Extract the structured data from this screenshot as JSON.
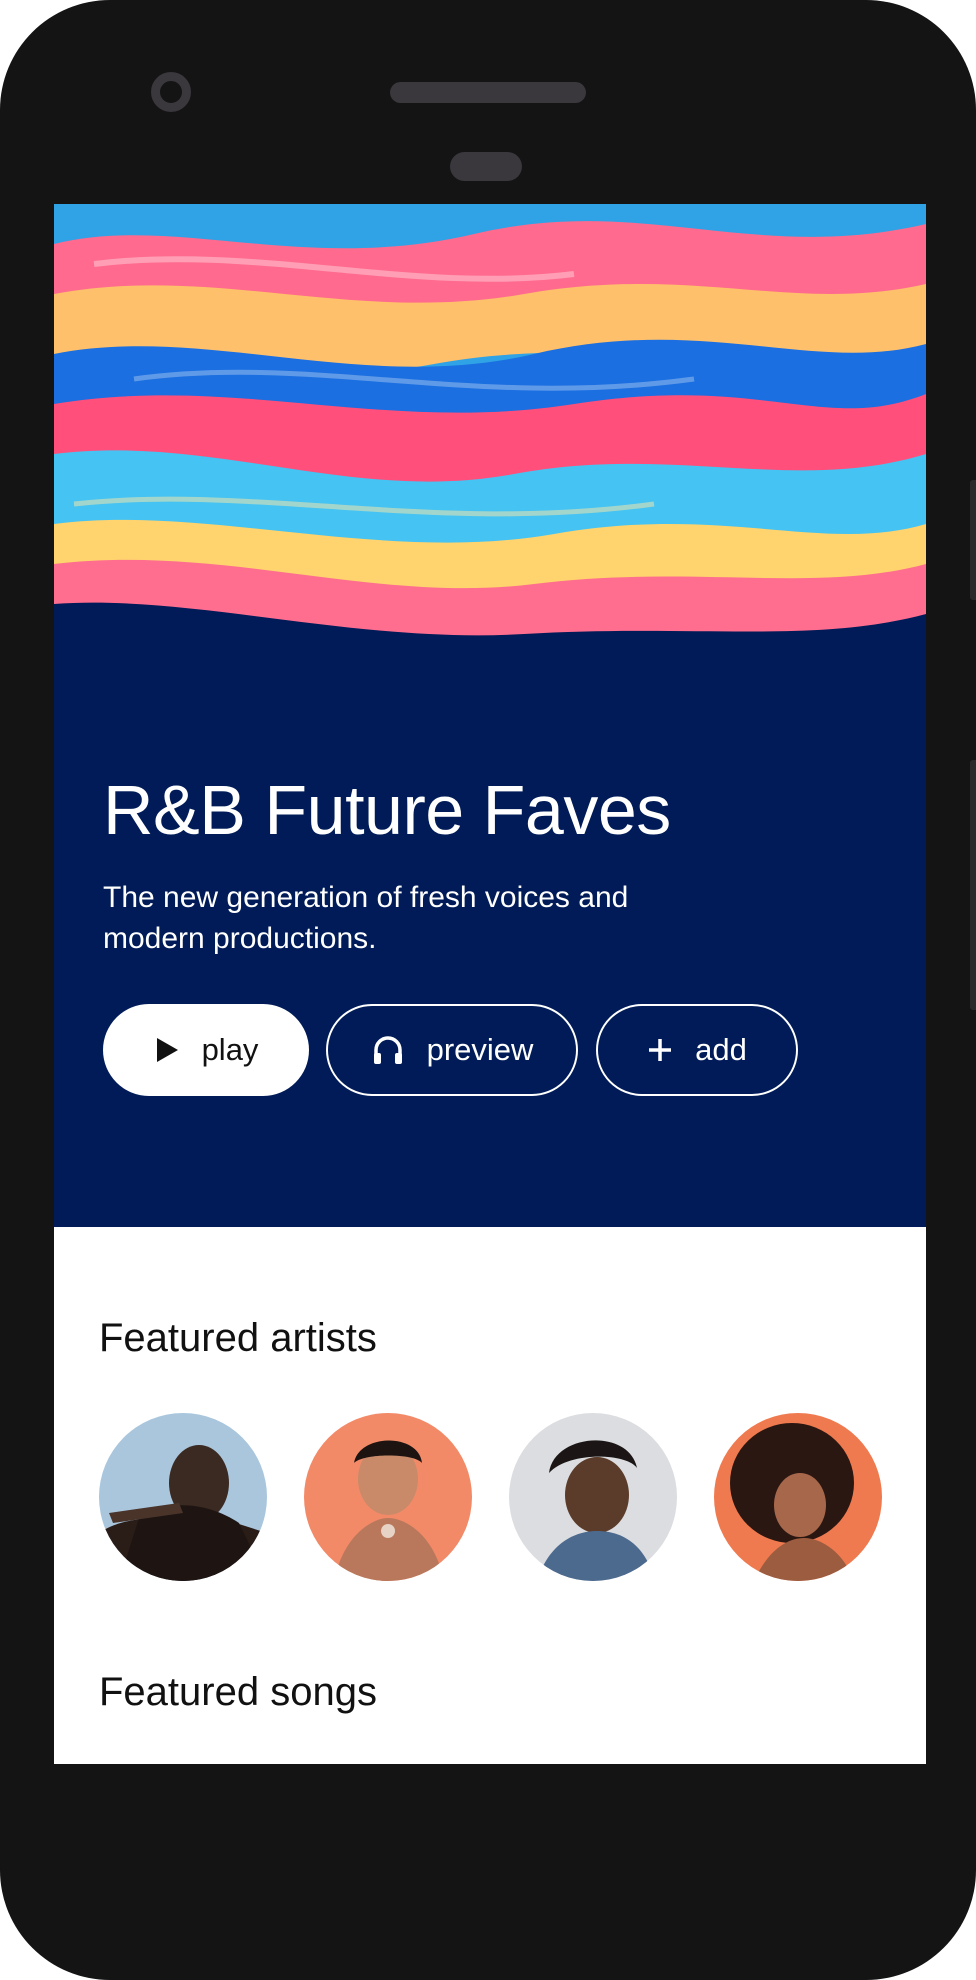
{
  "playlist": {
    "title": "R&B Future Faves",
    "description": "The new generation of fresh voices and modern productions."
  },
  "actions": {
    "play_label": "play",
    "preview_label": "preview",
    "add_label": "add"
  },
  "sections": {
    "featured_artists_title": "Featured artists",
    "featured_songs_title": "Featured songs"
  },
  "icons": {
    "play": "play-icon",
    "preview": "headphones-icon",
    "add": "plus-icon"
  },
  "colors": {
    "hero_background": "#001b57",
    "button_primary_bg": "#ffffff",
    "frame": "#141414"
  }
}
